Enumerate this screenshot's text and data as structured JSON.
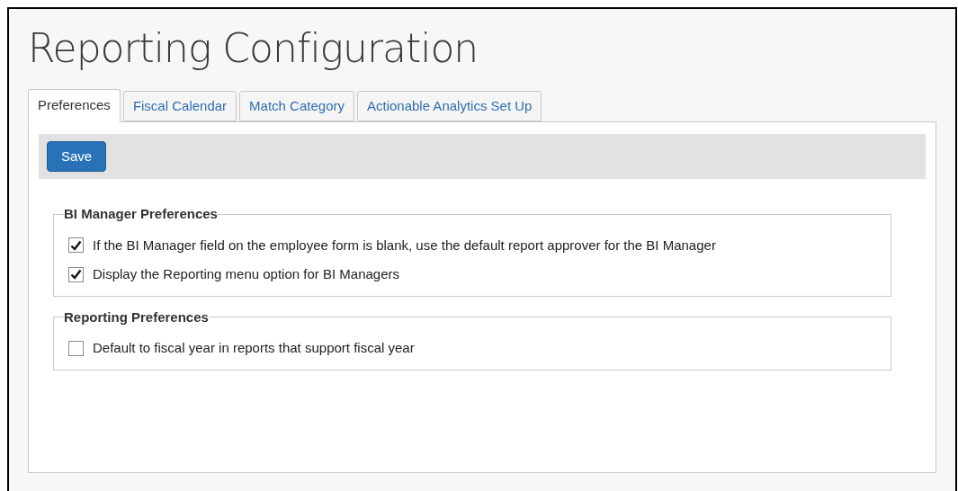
{
  "title": "Reporting Configuration",
  "tabs": [
    {
      "label": "Preferences",
      "selected": true
    },
    {
      "label": "Fiscal Calendar",
      "selected": false
    },
    {
      "label": "Match Category",
      "selected": false
    },
    {
      "label": "Actionable Analytics Set Up",
      "selected": false
    }
  ],
  "toolbar": {
    "save_button": "Save"
  },
  "sections": [
    {
      "legend": "BI Manager Preferences",
      "options": [
        {
          "label": "If the BI Manager field on the employee form is blank, use the default report approver for the BI Manager",
          "checked": true
        },
        {
          "label": "Display the Reporting menu option for BI Managers",
          "checked": true
        }
      ]
    },
    {
      "legend": "Reporting Preferences",
      "options": [
        {
          "label": "Default to fiscal year in reports that support fiscal year",
          "checked": false
        }
      ]
    }
  ]
}
